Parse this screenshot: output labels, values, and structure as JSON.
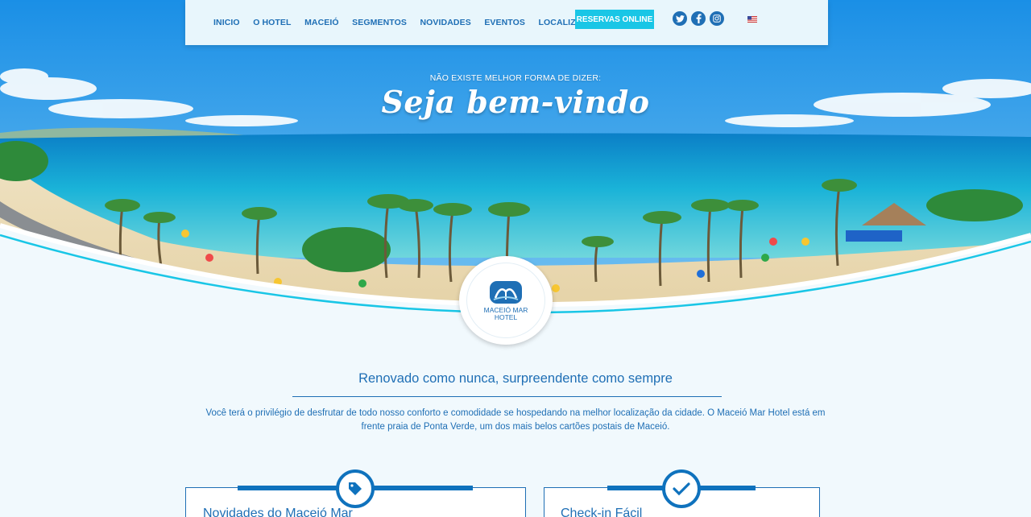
{
  "nav": {
    "links": [
      "INICIO",
      "O HOTEL",
      "MACEIÓ",
      "SEGMENTOS",
      "NOVIDADES",
      "EVENTOS",
      "LOCALIZAÇÃO"
    ],
    "reserve_label": "RESERVAS ONLINE",
    "social_icons": [
      "twitter-icon",
      "facebook-icon",
      "instagram-icon"
    ],
    "language_flag": "us-flag-icon"
  },
  "hero": {
    "subtitle": "NÃO EXISTE MELHOR FORMA DE DIZER:",
    "title": "Seja bem-vindo"
  },
  "logo": {
    "line1": "MACEIÓ MAR",
    "line2": "HOTEL"
  },
  "content": {
    "headline": "Renovado como nunca, surpreendente como sempre",
    "intro": "Você terá o privilégio de desfrutar de todo nosso conforto e comodidade se hospedando na melhor localização da cidade. O Maceió Mar Hotel está em frente praia de Ponta Verde, um dos mais belos cartões postais de Maceió."
  },
  "cards": [
    {
      "title": "Novidades do Maceió Mar",
      "icon": "tag-icon"
    },
    {
      "title": "Check-in Fácil",
      "icon": "check-icon"
    }
  ],
  "colors": {
    "brand_blue": "#1f6fb5",
    "accent_cyan": "#19c6e6",
    "background": "#f1f9fd"
  }
}
